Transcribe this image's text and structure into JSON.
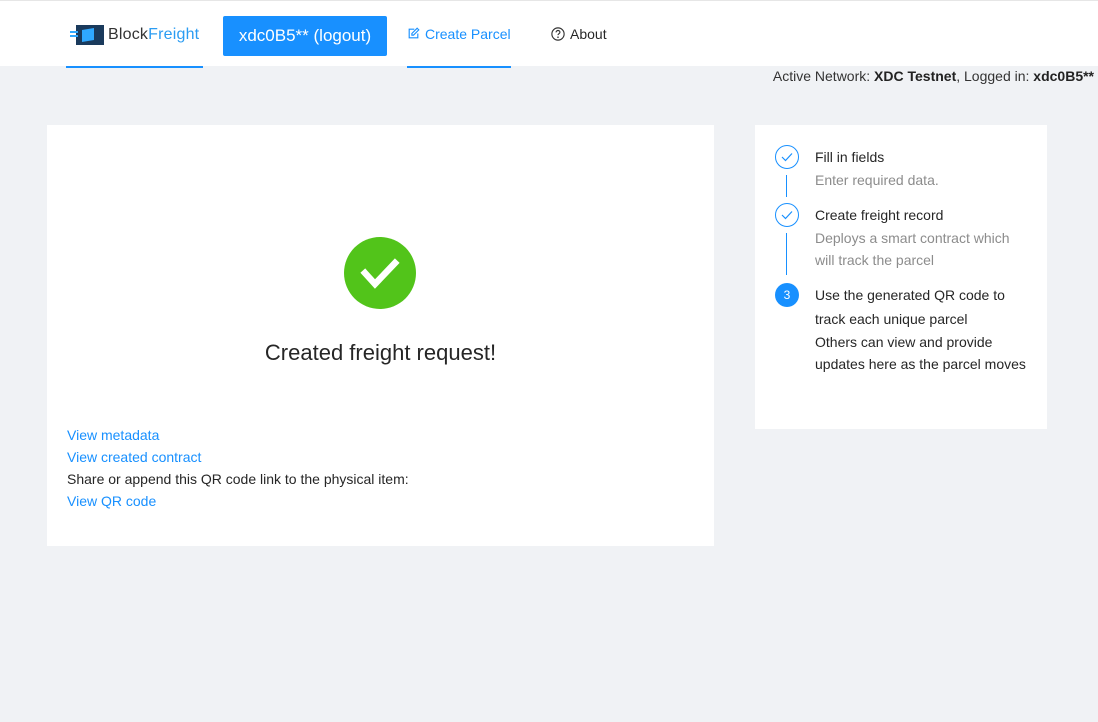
{
  "header": {
    "logo_text_main": "Block",
    "logo_text_accent": "Freight",
    "logout_label": "xdc0B5** (logout)",
    "menu": [
      {
        "label": "Create Parcel",
        "icon": "edit-icon",
        "active": true
      },
      {
        "label": "About",
        "icon": "question-circle-icon",
        "active": false
      }
    ]
  },
  "network": {
    "network_prefix": "Active Network: ",
    "network_name": "XDC Testnet",
    "login_prefix": ", Logged in: ",
    "login_user": "xdc0B5**"
  },
  "result": {
    "title": "Created freight request!",
    "view_metadata": "View metadata",
    "view_contract": "View created contract",
    "share_text": "Share or append this QR code link to the physical item:",
    "view_qr": "View QR code",
    "success_color": "#52c41a"
  },
  "steps": [
    {
      "status": "finish",
      "title": "Fill in fields",
      "description": "Enter required data."
    },
    {
      "status": "finish",
      "title": "Create freight record",
      "description": "Deploys a smart contract which will track the parcel"
    },
    {
      "status": "process",
      "number": "3",
      "title": "Use the generated QR code to track each unique parcel",
      "description": "Others can view and provide updates here as the parcel moves"
    }
  ],
  "colors": {
    "primary": "#1890ff",
    "background": "#f0f2f5",
    "success": "#52c41a"
  }
}
